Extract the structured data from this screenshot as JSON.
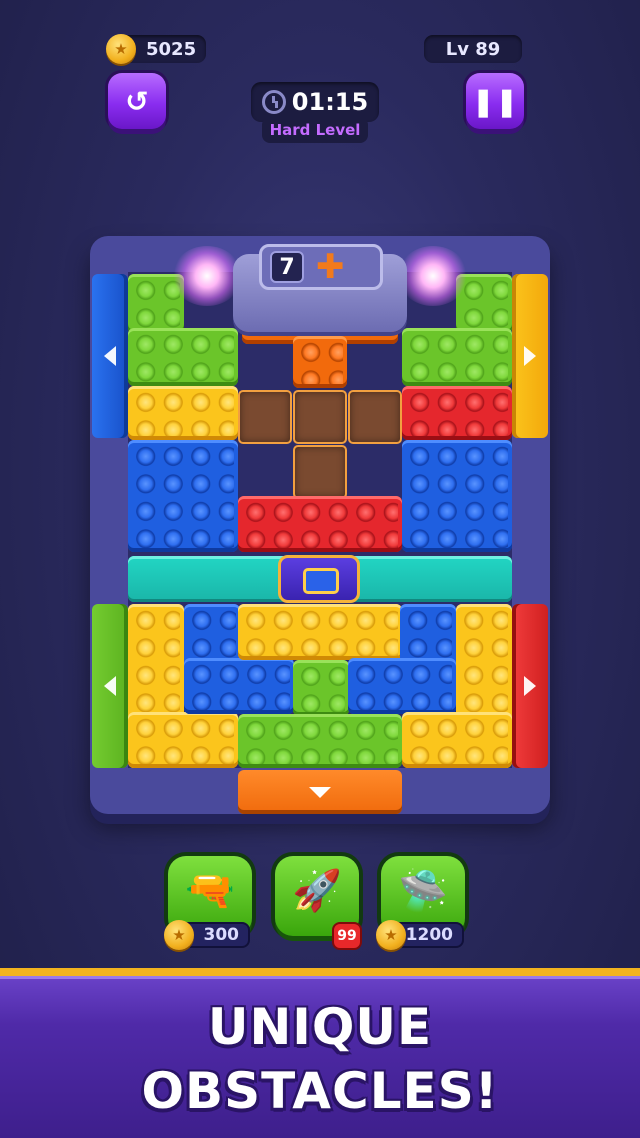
{
  "hud": {
    "coins": "5025",
    "level": "Lv 89",
    "timer": "01:15",
    "difficulty": "Hard Level"
  },
  "board": {
    "machine_count": "7",
    "machine_shape": "plus-piece",
    "colors": {
      "green": "#6bc52a",
      "yellow": "#fbc51c",
      "blue": "#1f5fe0",
      "red": "#e5272d",
      "orange": "#f26a0c",
      "teal_wall": "#22d6c4"
    },
    "gates": [
      "blue-left",
      "yellow-right",
      "green-left",
      "red-right",
      "orange-down"
    ]
  },
  "boosters": [
    {
      "name": "blaster-icon",
      "price": "300"
    },
    {
      "name": "rocket-icon",
      "count": "99"
    },
    {
      "name": "ufo-icon",
      "price": "1200"
    }
  ],
  "banner": {
    "line1": "UNIQUE",
    "line2": "OBSTACLES!"
  }
}
